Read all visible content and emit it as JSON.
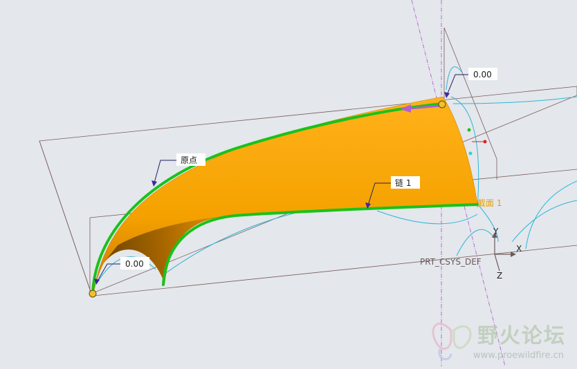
{
  "viewport": {
    "background": "#e4e7ec",
    "surface_color": "#f5a200",
    "chain_color": "#19c21a",
    "datum_curve_color": "#2ab6d6",
    "csys_color": "#6a5a5a"
  },
  "annotations": {
    "start_value": "0.00",
    "end_value": "0.00",
    "origin_label": "原点",
    "chain_label": "链 1",
    "section_label": "截面 1"
  },
  "csys": {
    "name": "PRT_CSYS_DEF",
    "x_label": "X",
    "y_label": "Y",
    "z_label": "Z"
  },
  "watermark": {
    "title": "野火论坛",
    "url": "www.proewildfire.cn"
  }
}
